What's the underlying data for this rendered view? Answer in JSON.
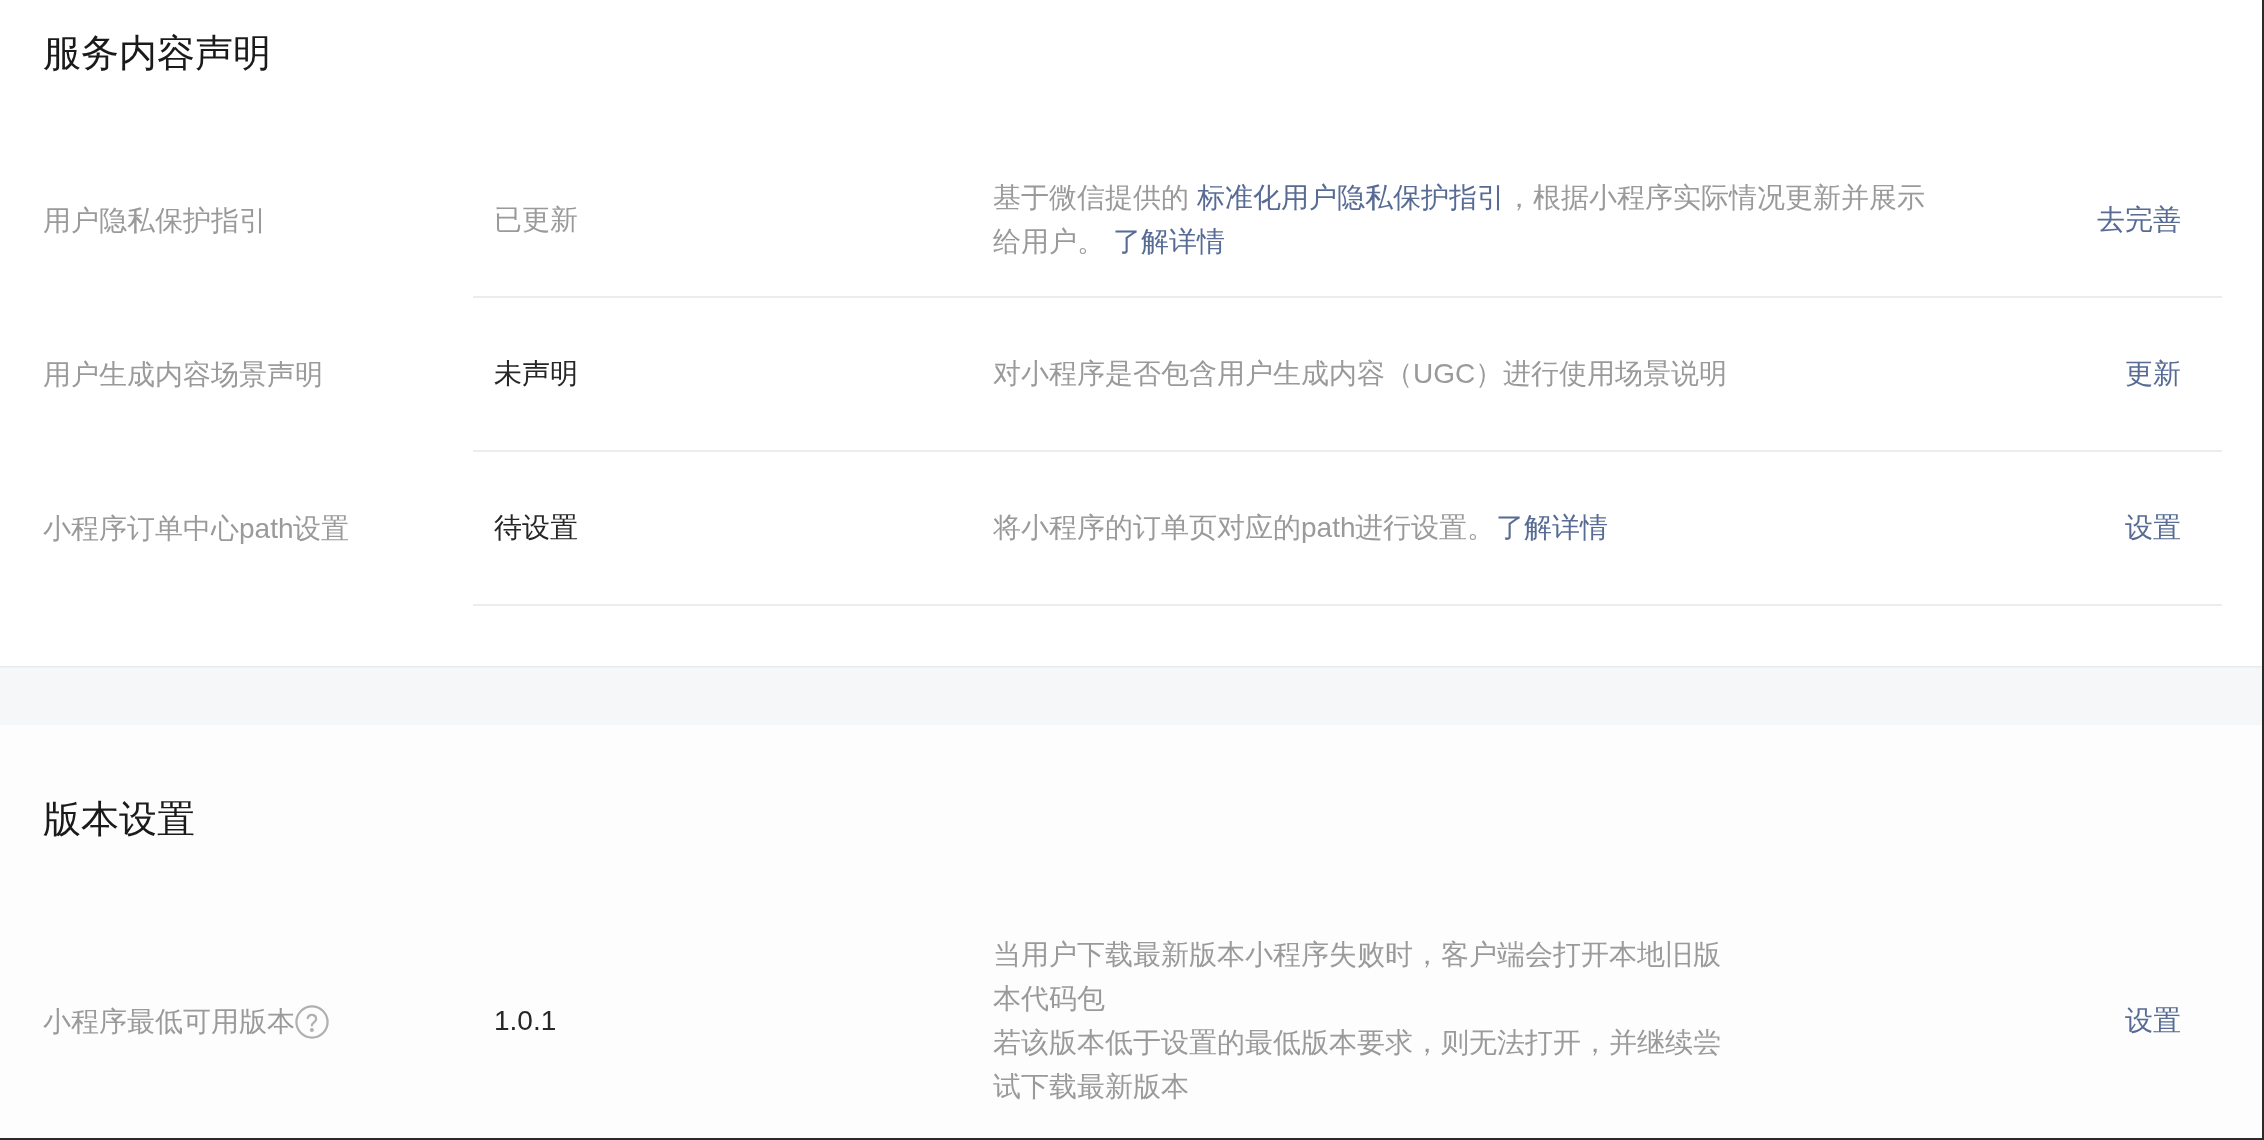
{
  "sections": [
    {
      "title": "服务内容声明",
      "rows": [
        {
          "label": "用户隐私保护指引",
          "help": false,
          "value": "已更新",
          "muted": true,
          "description": [
            [
              {
                "kind": "text",
                "text": "基于微信提供的 "
              },
              {
                "kind": "link",
                "text": "标准化用户隐私保护指引"
              },
              {
                "kind": "text",
                "text": "，根据小程序实际情况更新并展示给用户。 "
              },
              {
                "kind": "link",
                "text": "了解详情"
              }
            ]
          ],
          "action": "去完善"
        },
        {
          "label": "用户生成内容场景声明",
          "help": false,
          "value": "未声明",
          "muted": false,
          "description": [
            [
              {
                "kind": "text",
                "text": "对小程序是否包含用户生成内容（UGC）进行使用场景说明"
              }
            ]
          ],
          "action": "更新"
        },
        {
          "label": "小程序订单中心path设置",
          "help": false,
          "value": "待设置",
          "muted": false,
          "description": [
            [
              {
                "kind": "text",
                "text": "将小程序的订单页对应的path进行设置。"
              },
              {
                "kind": "link",
                "text": "了解详情"
              }
            ]
          ],
          "action": "设置"
        }
      ]
    },
    {
      "title": "版本设置",
      "rows": [
        {
          "label": "小程序最低可用版本",
          "help": true,
          "value": "1.0.1",
          "muted": false,
          "description": [
            [
              {
                "kind": "text",
                "text": "当用户下载最新版本小程序失败时，客户端会打开本地旧版本代码包"
              }
            ],
            [
              {
                "kind": "text",
                "text": "若该版本低于设置的最低版本要求，则无法打开，并继续尝试下载最新版本"
              }
            ]
          ],
          "action": "设置"
        }
      ]
    }
  ]
}
